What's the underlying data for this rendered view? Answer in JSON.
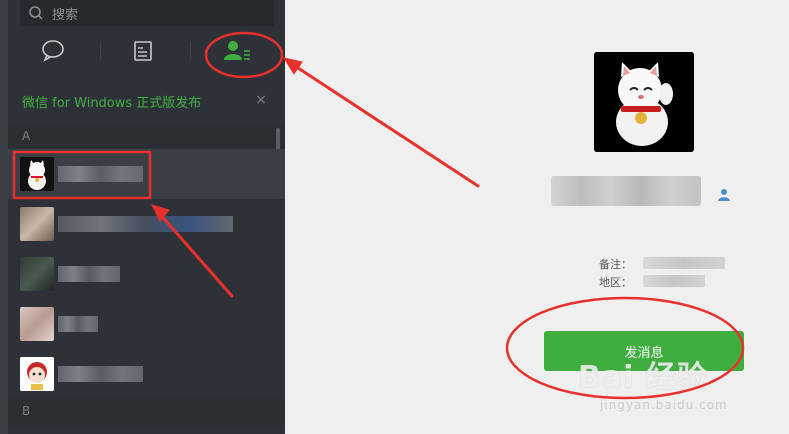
{
  "search": {
    "placeholder": "搜索"
  },
  "tabs": [
    "chat-icon",
    "favorites-icon",
    "contacts-icon"
  ],
  "banner": {
    "text": "微信 for Windows 正式版发布",
    "close": "×"
  },
  "sections": {
    "a": "A",
    "b": "B"
  },
  "contacts": [
    {
      "avatar": "lucky-cat",
      "selected": true
    },
    {
      "avatar": "photo"
    },
    {
      "avatar": "photo"
    },
    {
      "avatar": "photo"
    },
    {
      "avatar": "cartoon"
    }
  ],
  "detail": {
    "remark_label": "备注：",
    "region_label": "地区：",
    "send_button": "发消息"
  },
  "watermark": {
    "main": "Bai  经验",
    "sub": "jingyan.baidu.com"
  },
  "colors": {
    "sidebar": "#2e3238",
    "accent_green": "#41b041",
    "button_green": "#3fae3f",
    "annotation_red": "#e8312c"
  }
}
